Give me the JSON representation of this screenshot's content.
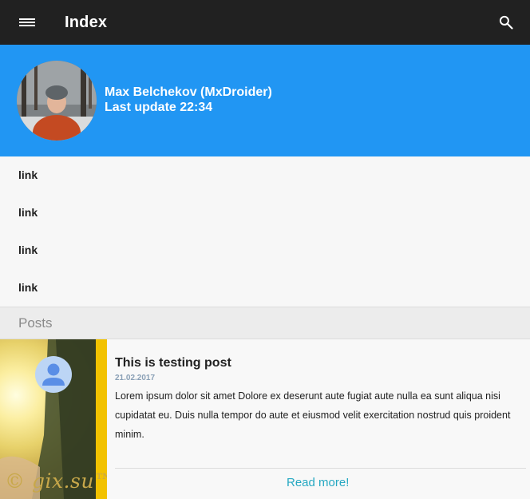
{
  "appbar": {
    "title": "Index",
    "menu_icon": "menu-icon",
    "search_icon": "search-icon",
    "background": "#212121"
  },
  "profile": {
    "name": "Max Belchekov (MxDroider)",
    "last_update": "Last update 22:34",
    "background": "#2196f3"
  },
  "nav": {
    "links": [
      {
        "label": "link"
      },
      {
        "label": "link"
      },
      {
        "label": "link"
      },
      {
        "label": "link"
      }
    ]
  },
  "posts": {
    "header": "Posts",
    "items": [
      {
        "title": "This is testing post",
        "date": "21.02.2017",
        "text": "Lorem ipsum dolor sit amet Dolore ex deserunt aute fugiat aute nulla ea sunt aliqua nisi cupidatat eu. Duis nulla tempor do aute et eiusmod velit exercitation nostrud quis proident minim.",
        "read_more": "Read more!",
        "image_icon": "person-placeholder-icon",
        "watermark": "© gix.su™"
      }
    ]
  },
  "colors": {
    "accent": "#2196f3",
    "link": "#26a8c2"
  }
}
